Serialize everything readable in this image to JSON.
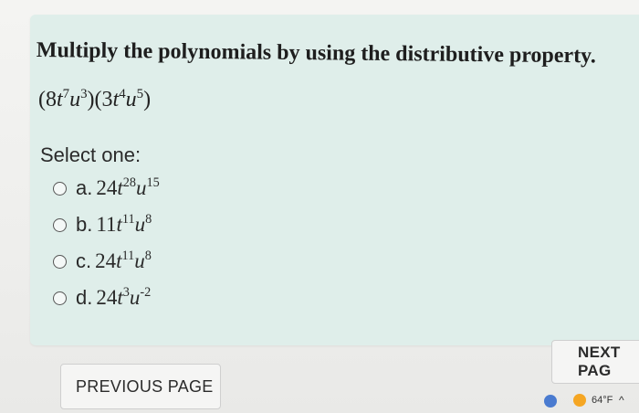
{
  "question": {
    "title": "Multiply the polynomials by using the distributive property."
  },
  "expression": {
    "open1": "(8",
    "t": "t",
    "exp_t1": "7",
    "u": "u",
    "exp_u1": "3",
    "mid": ")(3",
    "exp_t2": "4",
    "exp_u2": "5",
    "close": ")"
  },
  "select_label": "Select one:",
  "options": [
    {
      "letter": "a.",
      "coef": "24",
      "t_exp": "28",
      "u_exp": "15"
    },
    {
      "letter": "b.",
      "coef": "11",
      "t_exp": "11",
      "u_exp": "8"
    },
    {
      "letter": "c.",
      "coef": "24",
      "t_exp": "11",
      "u_exp": "8"
    },
    {
      "letter": "d.",
      "coef": "24",
      "t_exp": "3",
      "u_exp": "-2"
    }
  ],
  "buttons": {
    "previous": "PREVIOUS PAGE",
    "next": "NEXT PAG"
  },
  "taskbar": {
    "weather": "64°F",
    "weather_icon": "sun-icon",
    "chevron_icon": "chevron-up-icon"
  }
}
